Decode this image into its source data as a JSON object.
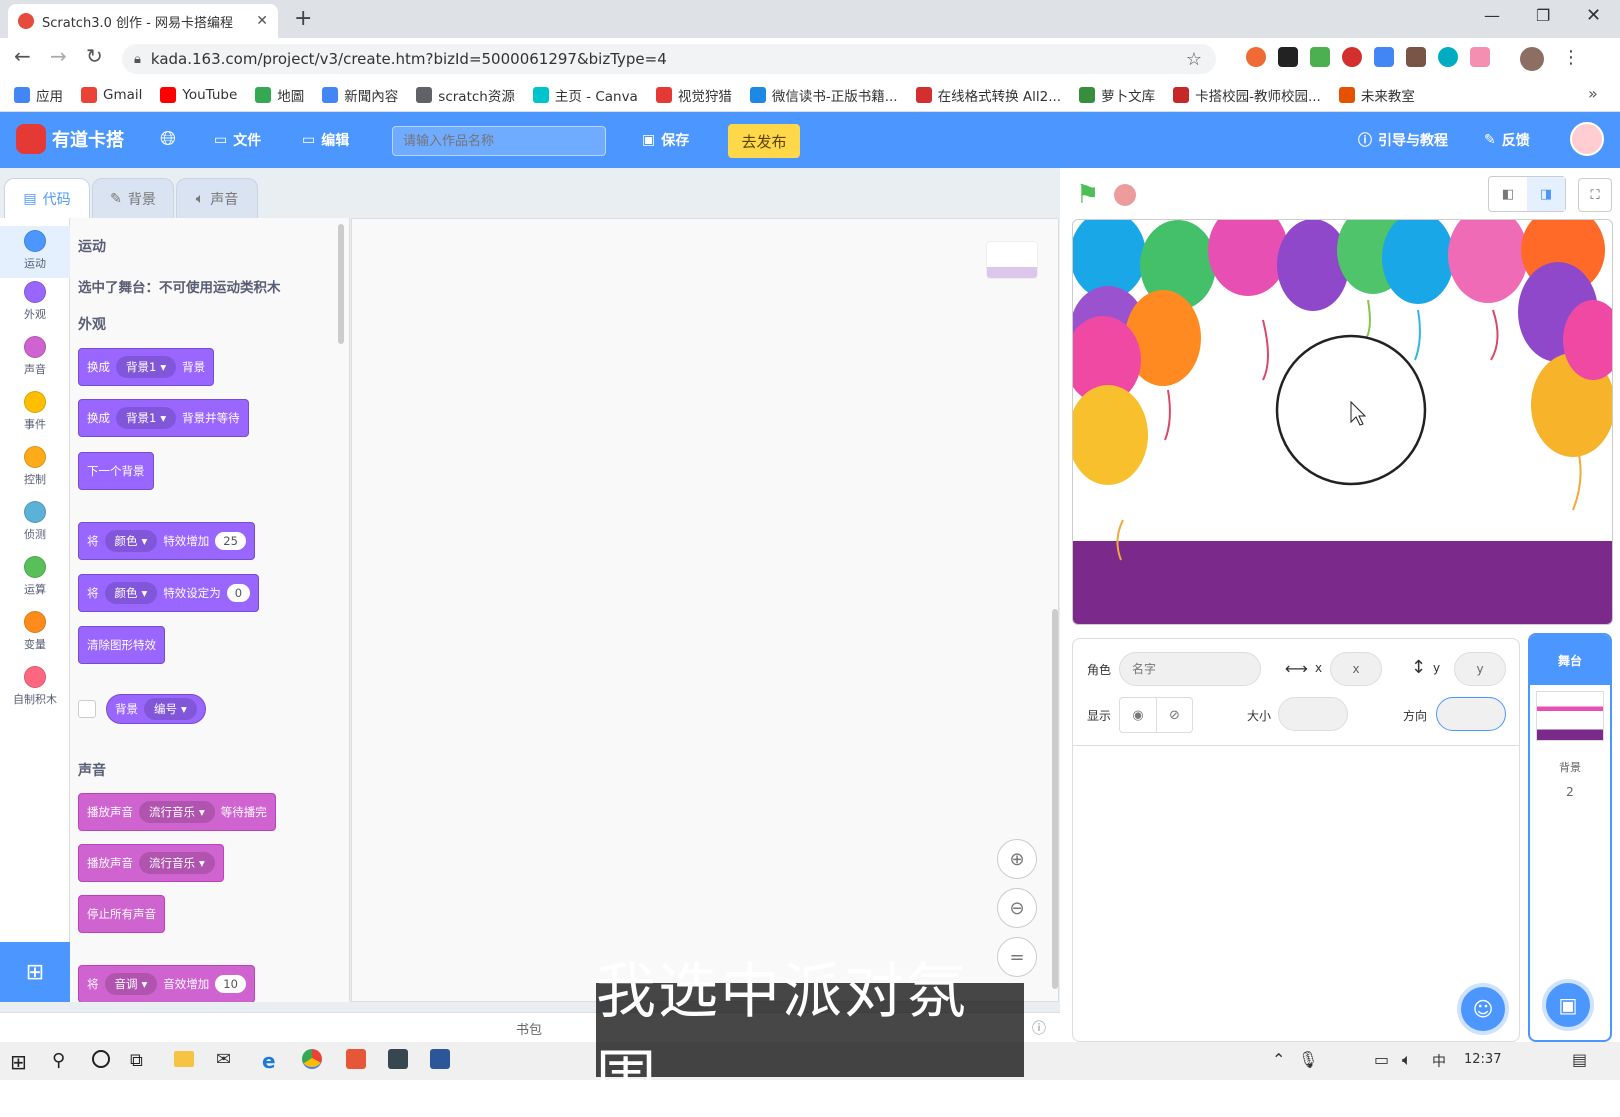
{
  "browser": {
    "tab_title": "Scratch3.0 创作 - 网易卡搭编程",
    "url": "kada.163.com/project/v3/create.htm?bizId=5000061297&bizType=4",
    "bookmarks": [
      "应用",
      "Gmail",
      "YouTube",
      "地圖",
      "新聞內容",
      "scratch资源",
      "主页 - Canva",
      "视觉狩猎",
      "微信读书-正版书籍...",
      "在线格式转换 All2...",
      "萝卜文库",
      "卡搭校园-教师校园...",
      "未来教室"
    ],
    "bookmark_colors": [
      "#4285f4",
      "#ea4335",
      "#ff0000",
      "#34a853",
      "#4285f4",
      "#5f6368",
      "#00c4cc",
      "#e53935",
      "#1e88e5",
      "#d32f2f",
      "#388e3c",
      "#c62828",
      "#e65100"
    ]
  },
  "header": {
    "logo": "有道卡搭",
    "file": "文件",
    "edit": "编辑",
    "project_placeholder": "请输入作品名称",
    "save": "保存",
    "publish": "去发布",
    "tutorial": "引导与教程",
    "feedback": "反馈"
  },
  "tabs": {
    "code": "代码",
    "backdrop": "背景",
    "sound": "声音"
  },
  "categories": [
    {
      "label": "运动",
      "color": "#4c97ff"
    },
    {
      "label": "外观",
      "color": "#9966ff"
    },
    {
      "label": "声音",
      "color": "#cf63cf"
    },
    {
      "label": "事件",
      "color": "#ffbf00"
    },
    {
      "label": "控制",
      "color": "#ffab19"
    },
    {
      "label": "侦测",
      "color": "#5cb1d6"
    },
    {
      "label": "运算",
      "color": "#59c059"
    },
    {
      "label": "变量",
      "color": "#ff8c1a"
    },
    {
      "label": "自制积木",
      "color": "#ff6680"
    }
  ],
  "palette": {
    "motion_title": "运动",
    "motion_note": "选中了舞台：不可使用运动类积木",
    "looks_title": "外观",
    "b1": {
      "a": "换成",
      "dd": "背景1",
      "b": "背景"
    },
    "b2": {
      "a": "换成",
      "dd": "背景1",
      "b": "背景并等待"
    },
    "b3": "下一个背景",
    "b4": {
      "a": "将",
      "dd": "颜色",
      "b": "特效增加",
      "n": "25"
    },
    "b5": {
      "a": "将",
      "dd": "颜色",
      "b": "特效设定为",
      "n": "0"
    },
    "b6": "清除图形特效",
    "b7": {
      "a": "背景",
      "dd": "编号"
    },
    "sound_title": "声音",
    "s1": {
      "a": "播放声音",
      "dd": "流行音乐",
      "b": "等待播完"
    },
    "s2": {
      "a": "播放声音",
      "dd": "流行音乐"
    },
    "s3": "停止所有声音",
    "s4": {
      "a": "将",
      "dd": "音调",
      "b": "音效增加",
      "n": "10"
    }
  },
  "backpack": "书包",
  "sprite": {
    "label": "角色",
    "name_placeholder": "名字",
    "x_label": "x",
    "x_placeholder": "x",
    "y_label": "y",
    "y_placeholder": "y",
    "show_label": "显示",
    "size_label": "大小",
    "direction_label": "方向"
  },
  "stage_panel": {
    "title": "舞台",
    "backdrops_label": "背景",
    "backdrops_count": "2"
  },
  "taskbar": {
    "ime": "中",
    "time": "12:37"
  },
  "subtitle": "我选中派对氛围"
}
